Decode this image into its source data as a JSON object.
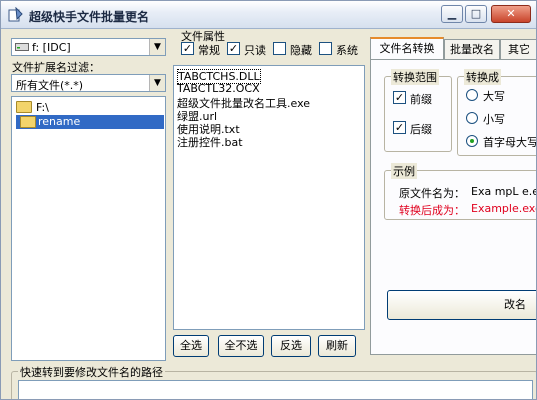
{
  "window": {
    "title": "超级快手文件批量更名"
  },
  "drive": {
    "value": "f: [IDC]"
  },
  "filter": {
    "label": "文件扩展名过滤：",
    "value": "所有文件(*.*)"
  },
  "tree": {
    "items": [
      {
        "label": "F:\\"
      },
      {
        "label": "rename"
      }
    ]
  },
  "attributes": {
    "title": "文件属性",
    "options": [
      {
        "label": "常规",
        "checked": true
      },
      {
        "label": "只读",
        "checked": true
      },
      {
        "label": "隐藏",
        "checked": false
      },
      {
        "label": "系统",
        "checked": false
      }
    ]
  },
  "files": [
    "TABCTCHS.DLL",
    "TABCTL32.OCX",
    "超级文件批量改名工具.exe",
    "绿盟.url",
    "使用说明.txt",
    "注册控件.bat"
  ],
  "buttons": {
    "select_all": "全选",
    "select_none": "全不选",
    "invert": "反选",
    "refresh": "刷新",
    "rename": "改名"
  },
  "tabs": [
    {
      "label": "文件名转换"
    },
    {
      "label": "批量改名"
    },
    {
      "label": "其它"
    }
  ],
  "scope": {
    "title": "转换范围",
    "prefix": "前缀",
    "suffix": "后缀"
  },
  "convert": {
    "title": "转换成",
    "upper": "大写",
    "lower": "小写",
    "capitalize": "首字母大写"
  },
  "example": {
    "title": "示例",
    "orig_label": "原文件名为：",
    "orig_value": "Exa mpL e.exE",
    "after_label": "转换后成为：",
    "after_value": "Example.exe"
  },
  "quickpath": {
    "label": "快速转到要修改文件名的路径"
  },
  "colors": {
    "accent_red": "#e0001e",
    "selection": "#316ac5"
  }
}
